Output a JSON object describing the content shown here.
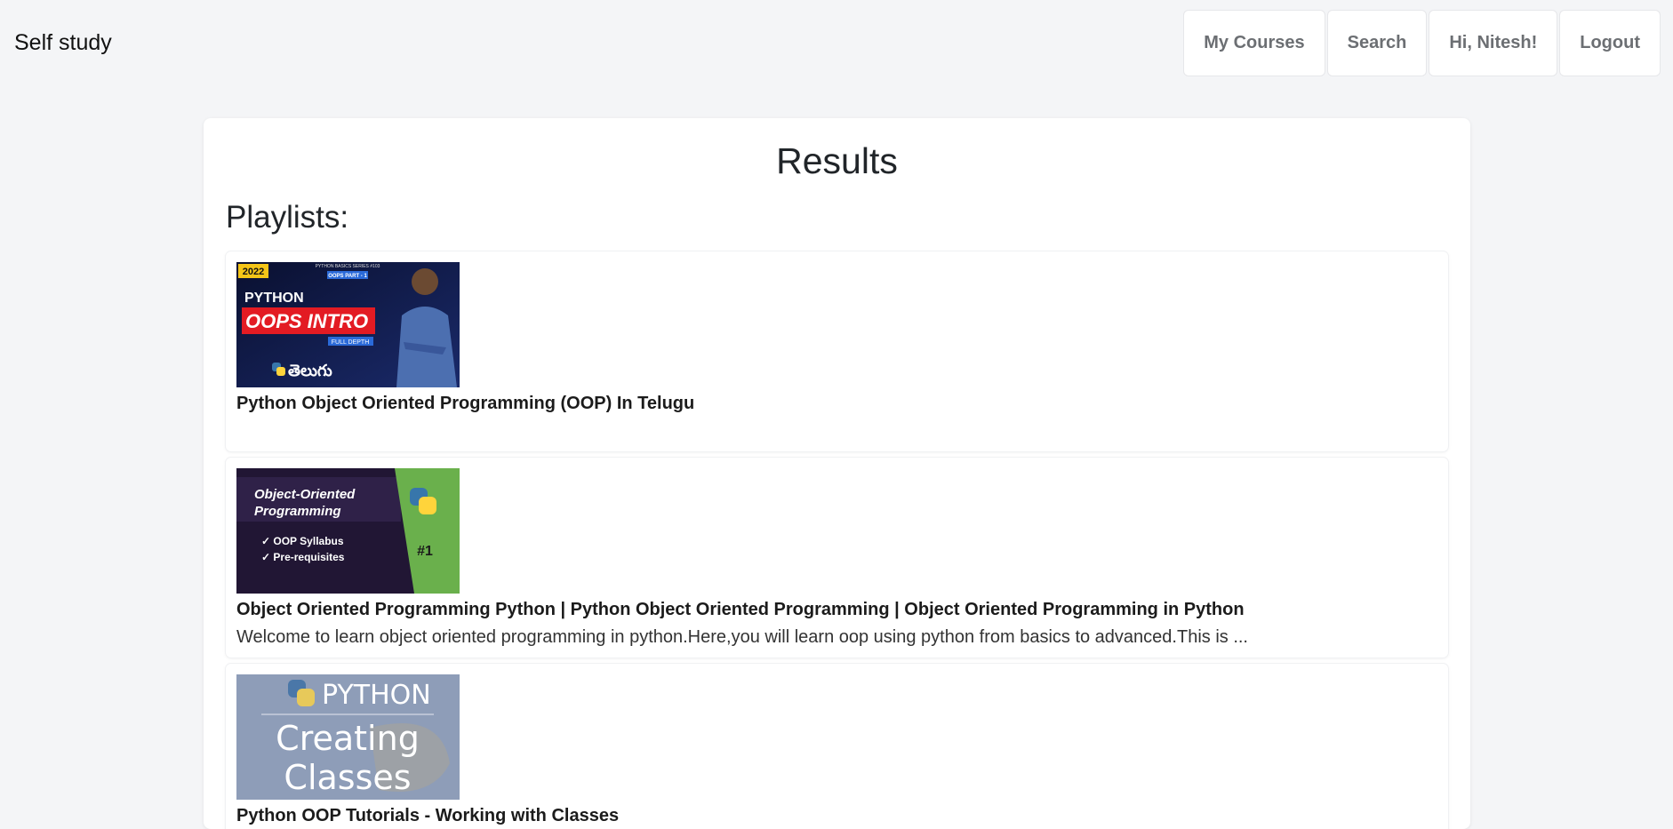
{
  "navbar": {
    "brand": "Self study",
    "links": [
      {
        "label": "My Courses"
      },
      {
        "label": "Search"
      },
      {
        "label": "Hi, Nitesh!"
      },
      {
        "label": "Logout"
      }
    ]
  },
  "main": {
    "title": "Results",
    "section_title": "Playlists:",
    "playlists": [
      {
        "title": "Python Object Oriented Programming (OOP) In Telugu",
        "description": "",
        "thumbnail": {
          "badge": "2022",
          "series": "PYTHON BASICS SERIES #103",
          "part": "OOPS PART - 1",
          "line1": "PYTHON",
          "line2": "OOPS INTRO",
          "line3": "FULL DEPTH",
          "lang": "తెలుగు"
        }
      },
      {
        "title": "Object Oriented Programming Python | Python Object Oriented Programming | Object Oriented Programming in Python",
        "description": "Welcome to learn object oriented programming in python.Here,you will learn oop using python from basics to advanced.This is ...",
        "thumbnail": {
          "line1": "Object-Oriented",
          "line2": "Programming",
          "item1": "✓ OOP Syllabus",
          "item2": "✓ Pre-requisites",
          "number": "#1"
        }
      },
      {
        "title": "Python OOP Tutorials - Working with Classes",
        "description": "",
        "thumbnail": {
          "line1": "PYTHON",
          "line2": "Creating",
          "line3": "Classes"
        }
      }
    ]
  }
}
